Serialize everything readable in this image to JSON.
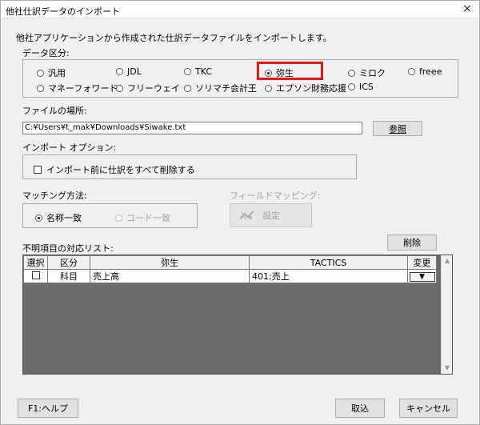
{
  "window": {
    "title": "他社仕訳データのインポート",
    "close_glyph": "×"
  },
  "intro_text": "他社アプリケーションから作成された仕訳データファイルをインポートします。",
  "data_category": {
    "label": "データ区分:",
    "options": [
      {
        "label": "汎用",
        "checked": false
      },
      {
        "label": "JDL",
        "checked": false
      },
      {
        "label": "TKC",
        "checked": false
      },
      {
        "label": "弥生",
        "checked": true
      },
      {
        "label": "ミロク",
        "checked": false
      },
      {
        "label": "freee",
        "checked": false
      },
      {
        "label": "マネーフォワード",
        "checked": false
      },
      {
        "label": "フリーウェイ",
        "checked": false
      },
      {
        "label": "ソリマチ会計王",
        "checked": false
      },
      {
        "label": "エプソン財務応援",
        "checked": false
      },
      {
        "label": "ICS",
        "checked": false
      }
    ]
  },
  "file_location": {
    "label": "ファイルの場所:",
    "value": "C:¥Users¥t_mak¥Downloads¥Siwake.txt",
    "browse_label": "参照"
  },
  "import_options": {
    "label": "インポート オプション:",
    "delete_before_label": "インポート前に仕訳をすべて削除する"
  },
  "matching": {
    "label": "マッチング方法:",
    "name_match": "名称一致",
    "code_match": "コード一致"
  },
  "field_mapping": {
    "label": "フィールドマッピング:",
    "settings_label": "設定"
  },
  "unknown_items": {
    "label": "不明項目の対応リスト:",
    "delete_label": "削除",
    "columns": [
      "選択",
      "区分",
      "弥生",
      "TACTICS",
      "変更"
    ],
    "rows": [
      {
        "select": "",
        "category": "科目",
        "yayoi": "売上高",
        "tactics": "401:売上",
        "change": "▼"
      }
    ]
  },
  "footer": {
    "help_label": "F1:ヘルプ",
    "import_label": "取込",
    "cancel_label": "キャンセル"
  }
}
